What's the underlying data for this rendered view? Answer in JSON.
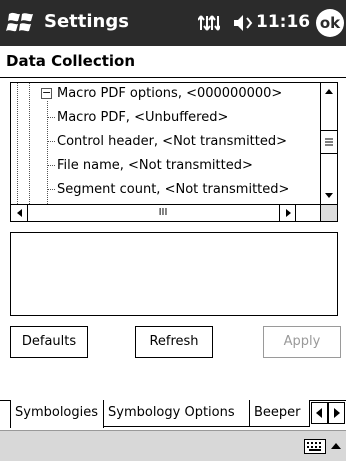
{
  "titlebar": {
    "title": "Settings",
    "clock": "11:16",
    "ok_label": "ok"
  },
  "page": {
    "section_title": "Data Collection"
  },
  "tree": {
    "items": [
      {
        "label": "Macro PDF options, <000000000>"
      },
      {
        "label": "Macro PDF, <Unbuffered>"
      },
      {
        "label": "Control header, <Not transmitted>"
      },
      {
        "label": "File name, <Not transmitted>"
      },
      {
        "label": "Segment count, <Not transmitted>"
      }
    ],
    "hscroll_grip": "III"
  },
  "buttons": {
    "defaults": "Defaults",
    "refresh": "Refresh",
    "apply": "Apply"
  },
  "tabs": [
    {
      "label": "Symbologies"
    },
    {
      "label": "Symbology Options"
    },
    {
      "label": "Beeper"
    }
  ],
  "colors": {
    "titlebar_bg": "#2b2b2b",
    "disabled_text": "#9a9a9a"
  }
}
